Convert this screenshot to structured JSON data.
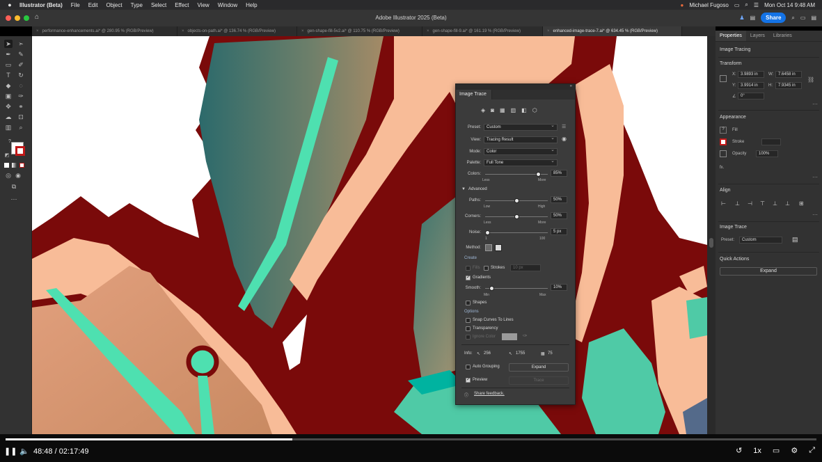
{
  "menubar": {
    "apple": "",
    "items": [
      "Illustrator (Beta)",
      "File",
      "Edit",
      "Object",
      "Type",
      "Select",
      "Effect",
      "View",
      "Window",
      "Help"
    ],
    "user": "Michael Fugoso",
    "datetime": "Mon Oct 14  9:48 AM"
  },
  "titlebar": {
    "title": "Adobe Illustrator 2025 (Beta)",
    "share": "Share"
  },
  "tabs": [
    "performance-enhancements.ai* @ 280.95 % (RGB/Preview)",
    "objects-on-path.ai* @ 136.74 % (RGB/Preview)",
    "gen-shape-fill-5v2.ai* @ 110.75 % (RGB/Preview)",
    "gen-shape-fill-9.ai* @ 161.19 % (RGB/Preview)",
    "enhanced-image-trace-7.ai* @ 634.45 % (RGB/Preview)"
  ],
  "properties": {
    "tabs": [
      "Properties",
      "Layers",
      "Libraries"
    ],
    "context": "Image Tracing",
    "transform_label": "Transform",
    "x": "3.9893 in",
    "y": "3.9914 in",
    "w": "7.6458 in",
    "h": "7.9345 in",
    "x_label": "X:",
    "y_label": "Y:",
    "w_label": "W:",
    "h_label": "H:",
    "angle": "0°",
    "appearance_label": "Appearance",
    "fill_label": "Fill",
    "stroke_label": "Stroke",
    "opacity_label": "Opacity",
    "opacity": "100%",
    "fx": "fx.",
    "align_label": "Align",
    "image_trace_label": "Image Trace",
    "preset_label": "Preset:",
    "preset": "Custom",
    "quick_actions_label": "Quick Actions",
    "expand": "Expand"
  },
  "image_trace": {
    "title": "Image Trace",
    "preset_label": "Preset:",
    "preset": "Custom",
    "view_label": "View:",
    "view": "Tracing Result",
    "mode_label": "Mode:",
    "mode": "Color",
    "palette_label": "Palette:",
    "palette": "Full Tone",
    "colors_label": "Colors:",
    "colors": "85%",
    "colors_fraction": 0.85,
    "less": "Less",
    "more": "More",
    "advanced": "Advanced",
    "paths_label": "Paths:",
    "paths": "50%",
    "paths_fraction": 0.5,
    "low": "Low",
    "high": "High",
    "corners_label": "Corners:",
    "corners": "50%",
    "corners_fraction": 0.5,
    "noise_label": "Noise:",
    "noise": "5 px",
    "noise_fraction": 0.04,
    "noise_min": "1",
    "noise_max": "100",
    "method_label": "Method:",
    "create_label": "Create",
    "fills": "Fills",
    "strokes": "Strokes",
    "stroke_px": "10 px",
    "gradients": "Gradients",
    "smooth_label": "Smooth:",
    "smooth": "10%",
    "smooth_fraction": 0.1,
    "min": "Min",
    "max": "Max",
    "shapes": "Shapes",
    "options_label": "Options",
    "snap_curves": "Snap Curves To Lines",
    "transparency": "Transparency",
    "ignore_color": "Ignore Color",
    "info_label": "Info:",
    "info_paths": "256",
    "info_anchors": "1755",
    "info_colors": "75",
    "auto_grouping": "Auto Grouping",
    "expand": "Expand",
    "preview": "Preview",
    "trace": "Trace",
    "share_feedback": "Share feedback."
  },
  "player": {
    "current": "48:48",
    "separator": "/",
    "total": "02:17:49",
    "progress_fraction": 0.354,
    "speed": "1x"
  },
  "colors": {
    "maroon": "#7a0a0a",
    "peach": "#f8bc98",
    "mint": "#4ee0b0",
    "teal": "#2f6b6b",
    "accent": "#1473e6"
  }
}
